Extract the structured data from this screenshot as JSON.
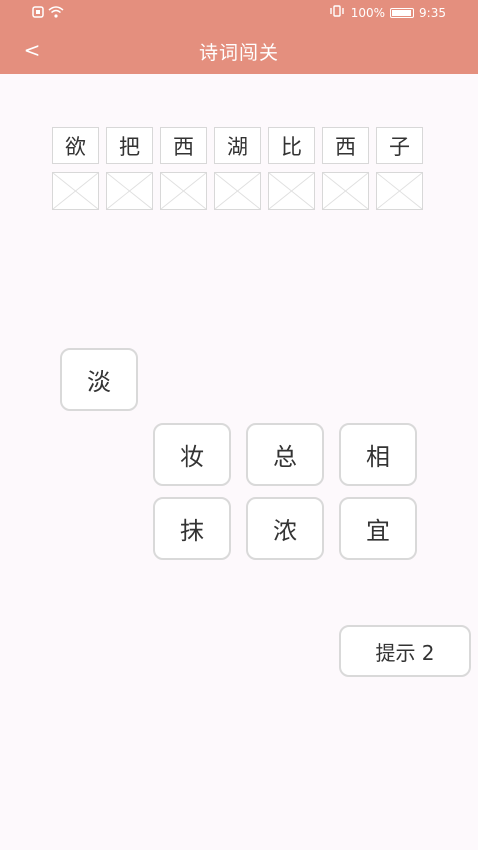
{
  "status": {
    "battery": "100%",
    "time": "9:35"
  },
  "header": {
    "back_label": "<",
    "title": "诗词闯关"
  },
  "poem": {
    "chars": [
      "欲",
      "把",
      "西",
      "湖",
      "比",
      "西",
      "子"
    ],
    "answer_slots": [
      "",
      "",
      "",
      "",
      "",
      "",
      ""
    ]
  },
  "choices": [
    "淡",
    "妆",
    "总",
    "相",
    "抹",
    "浓",
    "宜"
  ],
  "hint": {
    "label": "提示 2"
  },
  "colors": {
    "header": "#e48f7e",
    "background": "#fdf9fc"
  }
}
